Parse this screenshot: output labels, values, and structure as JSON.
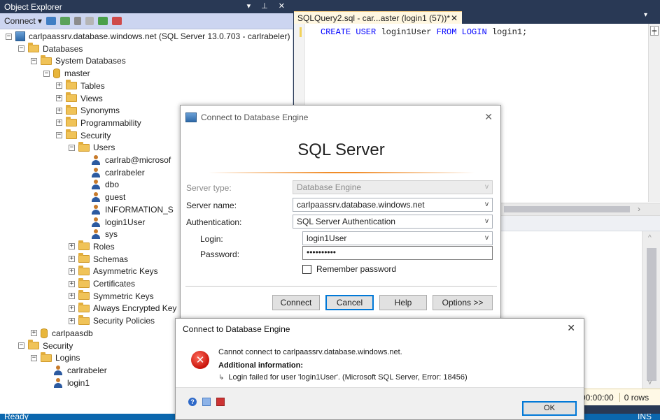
{
  "object_explorer": {
    "title": "Object Explorer",
    "title_controls": "▾ ⊥ ✕",
    "connect_label": "Connect ▾",
    "tree": [
      {
        "label": "carlpaassrv.database.windows.net (SQL Server 13.0.703 - carlrabeler)",
        "toggle": "−",
        "icon": "server-icon",
        "level": 0
      },
      {
        "label": "Databases",
        "toggle": "−",
        "icon": "folder-icon",
        "level": 1
      },
      {
        "label": "System Databases",
        "toggle": "−",
        "icon": "folder-icon",
        "level": 2
      },
      {
        "label": "master",
        "toggle": "−",
        "icon": "database-icon",
        "level": 3
      },
      {
        "label": "Tables",
        "toggle": "+",
        "icon": "folder-icon",
        "level": 4
      },
      {
        "label": "Views",
        "toggle": "+",
        "icon": "folder-icon",
        "level": 4
      },
      {
        "label": "Synonyms",
        "toggle": "+",
        "icon": "folder-icon",
        "level": 4
      },
      {
        "label": "Programmability",
        "toggle": "+",
        "icon": "folder-icon",
        "level": 4
      },
      {
        "label": "Security",
        "toggle": "−",
        "icon": "folder-icon",
        "level": 4
      },
      {
        "label": "Users",
        "toggle": "−",
        "icon": "folder-icon",
        "level": 5
      },
      {
        "label": "carlrab@microsof",
        "toggle": "",
        "icon": "user-icon",
        "level": 6
      },
      {
        "label": "carlrabeler",
        "toggle": "",
        "icon": "user-icon",
        "level": 6
      },
      {
        "label": "dbo",
        "toggle": "",
        "icon": "user-icon",
        "level": 6
      },
      {
        "label": "guest",
        "toggle": "",
        "icon": "user-icon",
        "level": 6
      },
      {
        "label": "INFORMATION_S",
        "toggle": "",
        "icon": "user-icon",
        "level": 6
      },
      {
        "label": "login1User",
        "toggle": "",
        "icon": "user-icon",
        "level": 6
      },
      {
        "label": "sys",
        "toggle": "",
        "icon": "user-icon",
        "level": 6
      },
      {
        "label": "Roles",
        "toggle": "+",
        "icon": "folder-icon",
        "level": 5
      },
      {
        "label": "Schemas",
        "toggle": "+",
        "icon": "folder-icon",
        "level": 5
      },
      {
        "label": "Asymmetric Keys",
        "toggle": "+",
        "icon": "folder-icon",
        "level": 5
      },
      {
        "label": "Certificates",
        "toggle": "+",
        "icon": "folder-icon",
        "level": 5
      },
      {
        "label": "Symmetric Keys",
        "toggle": "+",
        "icon": "folder-icon",
        "level": 5
      },
      {
        "label": "Always Encrypted Key",
        "toggle": "+",
        "icon": "folder-icon",
        "level": 5
      },
      {
        "label": "Security Policies",
        "toggle": "+",
        "icon": "folder-icon",
        "level": 5
      },
      {
        "label": "carlpaasdb",
        "toggle": "+",
        "icon": "database-icon",
        "level": 2
      },
      {
        "label": "Security",
        "toggle": "−",
        "icon": "folder-icon",
        "level": 1
      },
      {
        "label": "Logins",
        "toggle": "−",
        "icon": "folder-icon",
        "level": 2
      },
      {
        "label": "carlrabeler",
        "toggle": "",
        "icon": "user-icon",
        "level": 3
      },
      {
        "label": "login1",
        "toggle": "",
        "icon": "user-icon",
        "level": 3
      }
    ]
  },
  "query_tab": {
    "label": "SQLQuery2.sql - car...aster (login1 (57))*",
    "close": "✕",
    "overflow": "▾"
  },
  "query_editor": {
    "code_keyword1": "CREATE USER",
    "code_text1": " login1User ",
    "code_keyword2": "FROM LOGIN",
    "code_text2": " login1;",
    "split_glyph": "╪",
    "hscroll_arrow": "›"
  },
  "results": {
    "elapsed": "00:00:00",
    "rows": "0 rows"
  },
  "status_bar": {
    "left": "Ready",
    "right": "INS"
  },
  "connect_dialog": {
    "title": "Connect to Database Engine",
    "close": "✕",
    "brand": "SQL Server",
    "server_type_label": "Server type:",
    "server_type_value": "Database Engine",
    "server_name_label": "Server name:",
    "server_name_value": "carlpaassrv.database.windows.net",
    "auth_label": "Authentication:",
    "auth_value": "SQL Server Authentication",
    "login_label": "Login:",
    "login_value": "login1User",
    "password_label": "Password:",
    "password_value": "••••••••••",
    "remember_label": "Remember password",
    "buttons": {
      "connect": "Connect",
      "cancel": "Cancel",
      "help": "Help",
      "options": "Options >>"
    }
  },
  "error_dialog": {
    "title": "Connect to Database Engine",
    "close": "✕",
    "message": "Cannot connect to carlpaassrv.database.windows.net.",
    "additional": "Additional information:",
    "detail": "Login failed for user 'login1User'. (Microsoft SQL Server, Error: 18456)",
    "ok": "OK"
  },
  "colors": {
    "chrome": "#293955",
    "status_bar": "#0b67ae",
    "tab_active": "#fff7e1",
    "keyword": "#0000ff",
    "error": "#c8140b"
  }
}
